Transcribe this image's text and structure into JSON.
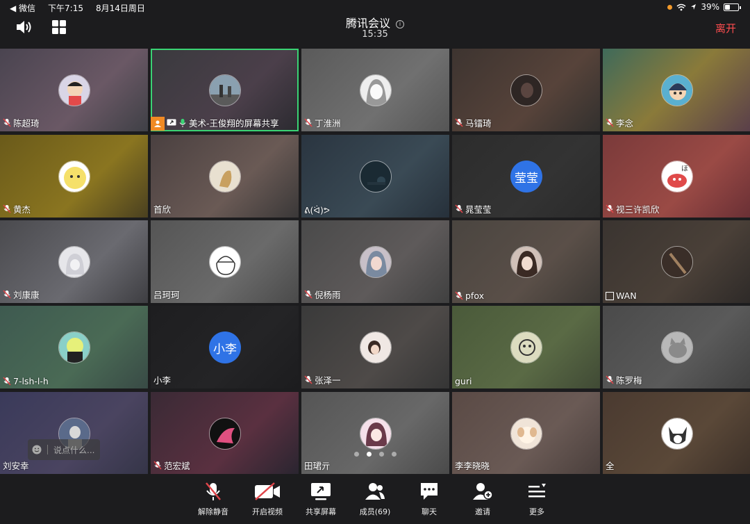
{
  "status": {
    "back_app": "◀ 微信",
    "time": "下午7:15",
    "date": "8月14日周日",
    "battery": "39%",
    "battery_level": 0.39
  },
  "header": {
    "title": "腾讯会议",
    "duration": "15:35",
    "leave": "离开",
    "info_glyph": "i"
  },
  "tiles": [
    {
      "name": "陈超琦",
      "muted": true,
      "bg": "linear-gradient(135deg,#4a4450,#6a5865 60%,#3f4046)",
      "avatar": "cartoon-kid"
    },
    {
      "name": "美术-王俊翔的屏幕共享",
      "muted": false,
      "sharing": true,
      "active": true,
      "bg": "linear-gradient(135deg,#3a3a3e,#4b3f4a 60%,#2b2a30)",
      "avatar": "street-photo"
    },
    {
      "name": "丁淮洲",
      "muted": true,
      "bg": "linear-gradient(135deg,#5a5a5a,#707070 60%,#555)",
      "avatar": "anime-girl"
    },
    {
      "name": "马镭琦",
      "muted": true,
      "bg": "linear-gradient(135deg,#3d3430,#57433a 60%,#32302e)",
      "avatar": "dark-photo"
    },
    {
      "name": "李念",
      "muted": true,
      "bg": "linear-gradient(135deg,#3f6a5a,#8a7a3a 50%,#5a3f4a)",
      "avatar": "anime-boy"
    },
    {
      "name": "黄杰",
      "muted": true,
      "bg": "linear-gradient(135deg,#6a5a1a,#8a7520 60%,#4a4020)",
      "avatar": "yellow-face"
    },
    {
      "name": "首欣",
      "muted": false,
      "bg": "linear-gradient(135deg,#4a4040,#6a5a55 60%,#3a3838)",
      "avatar": "sketch"
    },
    {
      "name": "ᕕ(ᐛ)ᕗ",
      "muted": false,
      "bg": "linear-gradient(135deg,#2a3540,#3a4a55 60%,#26303a)",
      "avatar": "dark-tree"
    },
    {
      "name": "晁莹莹",
      "muted": true,
      "bg": "linear-gradient(135deg,#2c2c2c,#333 60%,#2a2a2a)",
      "avatar_text": "莹莹"
    },
    {
      "name": "视三许凯欣",
      "muted": true,
      "bg": "linear-gradient(135deg,#7a3a3a,#9a4a45 60%,#6a3035)",
      "avatar": "red-crab"
    },
    {
      "name": "刘康康",
      "muted": true,
      "bg": "linear-gradient(135deg,#4a4a4e,#6a6a70 60%,#3e3e42)",
      "avatar": "white-hood"
    },
    {
      "name": "吕珂珂",
      "muted": false,
      "bg": "linear-gradient(135deg,#555,#6a6a6a 60%,#4a4a4a)",
      "avatar": "sketch-face"
    },
    {
      "name": "倪杨雨",
      "muted": true,
      "bg": "linear-gradient(135deg,#4a4a4a,#5e5a5a 60%,#404040)",
      "avatar": "girl-photo"
    },
    {
      "name": "pfox",
      "muted": true,
      "bg": "linear-gradient(135deg,#4a4540,#5a4f48 60%,#3c3834)",
      "avatar": "woman-photo"
    },
    {
      "name": "WAN",
      "muted": false,
      "checkbox": true,
      "bg": "linear-gradient(135deg,#3a3430,#4a4038 60%,#2e2a28)",
      "avatar": "guitar"
    },
    {
      "name": "7-lsh-l-h",
      "muted": true,
      "bg": "linear-gradient(135deg,#3e5a50,#4a6a55 60%,#384a45)",
      "avatar": "green-cartoon"
    },
    {
      "name": "小李",
      "muted": false,
      "bg": "linear-gradient(135deg,#1e1e20,#242426 60%,#1c1c1e)",
      "avatar_text": "小李"
    },
    {
      "name": "张泽一",
      "muted": true,
      "bg": "linear-gradient(135deg,#3a3a3a,#4e4a48 60%,#353535)",
      "avatar": "bed-photo"
    },
    {
      "name": "guri",
      "muted": false,
      "bg": "linear-gradient(135deg,#4a5a3a,#5a6a45 60%,#404a35)",
      "avatar": "doodle"
    },
    {
      "name": "陈罗梅",
      "muted": true,
      "bg": "linear-gradient(135deg,#4a4a4a,#5a5a5a 60%,#404040)",
      "avatar": "cat"
    },
    {
      "name": "刘安幸",
      "muted": false,
      "bg": "linear-gradient(135deg,#3a3a5a,#4a4460 60%,#353548)",
      "avatar": "statue"
    },
    {
      "name": "范宏斌",
      "muted": true,
      "bg": "linear-gradient(135deg,#3a2a35,#5a3040 60%,#2a2530)",
      "avatar": "pink-splash"
    },
    {
      "name": "田珺亓",
      "muted": false,
      "bg": "linear-gradient(135deg,#555,#686868 60%,#4a4a4a)",
      "avatar": "pink-girl"
    },
    {
      "name": "李李晓晓",
      "muted": false,
      "bg": "linear-gradient(135deg,#5a4a45,#6a5a55 60%,#4a3f3c)",
      "avatar": "cream-dog"
    },
    {
      "name": "全",
      "muted": false,
      "bg": "linear-gradient(135deg,#4a3a30,#5a4838 60%,#3c3028)",
      "avatar": "husky"
    }
  ],
  "chat": {
    "placeholder": "说点什么..."
  },
  "pages": {
    "count": 4,
    "current": 1
  },
  "toolbar": [
    {
      "id": "unmute",
      "label": "解除静音",
      "icon": "mic-off-icon"
    },
    {
      "id": "video",
      "label": "开启视频",
      "icon": "camera-off-icon"
    },
    {
      "id": "share",
      "label": "共享屏幕",
      "icon": "share-screen-icon"
    },
    {
      "id": "members",
      "label": "成员(69)",
      "icon": "members-icon"
    },
    {
      "id": "chat",
      "label": "聊天",
      "icon": "chat-icon"
    },
    {
      "id": "invite",
      "label": "邀请",
      "icon": "invite-icon"
    },
    {
      "id": "more",
      "label": "更多",
      "icon": "more-icon"
    }
  ],
  "colors": {
    "accent_green": "#3ad374",
    "leave_red": "#ff4d4f",
    "share_orange": "#f08a24",
    "muted_red": "#e0454a"
  }
}
